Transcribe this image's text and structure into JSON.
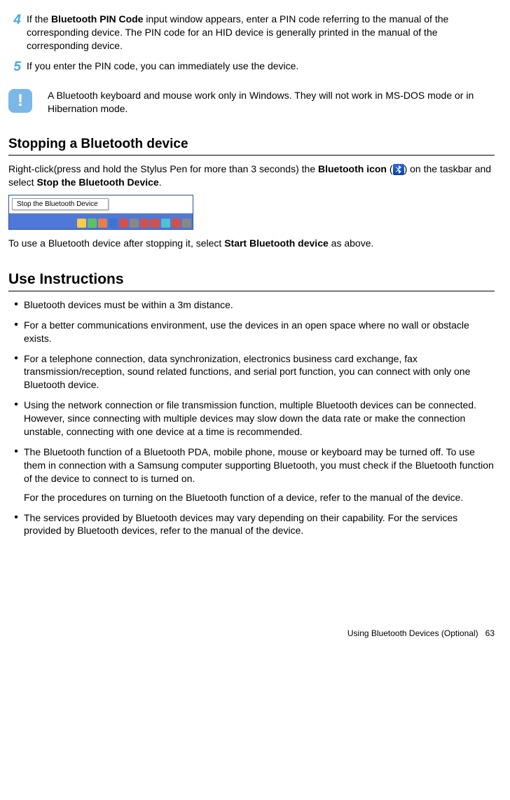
{
  "steps": [
    {
      "num": "4",
      "html": "If the <b>Bluetooth PIN Code</b> input window appears, enter a PIN code referring to the manual of the corresponding device. The PIN code for an HID device is generally printed in the manual of the corresponding device."
    },
    {
      "num": "5",
      "html": "If you enter the PIN code, you can immediately use the device."
    }
  ],
  "note": {
    "icon_char": "!",
    "text": "A Bluetooth keyboard and mouse work only in Windows. They will not work in MS-DOS mode or in Hibernation mode."
  },
  "stopping": {
    "title": "Stopping a Bluetooth device",
    "para1_pre": "Right-click(press and hold the Stylus Pen for more than 3 seconds) the ",
    "para1_bold1": "Bluetooth icon",
    "para1_mid1": " (",
    "para1_mid2": ") on the taskbar and select ",
    "para1_bold2": "Stop the Bluetooth Device",
    "para1_end": ".",
    "menu_label": "Stop the Bluetooth Device",
    "para2_pre": "To use a Bluetooth device after stopping it, select ",
    "para2_bold": "Start Bluetooth device",
    "para2_end": " as above."
  },
  "instructions": {
    "title": "Use Instructions",
    "bullets": [
      {
        "paras": [
          "Bluetooth devices must be within a 3m distance."
        ]
      },
      {
        "paras": [
          "For a better communications environment, use the devices in an open space where no wall or obstacle exists."
        ]
      },
      {
        "paras": [
          "For a telephone connection, data synchronization, electronics business card exchange, fax transmission/reception, sound related functions, and serial port function, you can connect with only one Bluetooth device."
        ]
      },
      {
        "paras": [
          "Using the network connection or file transmission function, multiple Bluetooth devices can be connected. However, since connecting with multiple devices may slow down the data rate or make the connection unstable, connecting with one device at a time is recommended."
        ]
      },
      {
        "paras": [
          "The Bluetooth function of a Bluetooth PDA, mobile phone, mouse or keyboard may be turned off. To use them in connection with a Samsung computer supporting Bluetooth, you must check if the Bluetooth function of the device to connect to is turned on.",
          "For the procedures on turning on the Bluetooth function of a device, refer to the manual of the device."
        ]
      },
      {
        "paras": [
          "The services provided by Bluetooth devices may vary depending on their capability. For the services provided by Bluetooth devices, refer to the manual of the device."
        ]
      }
    ]
  },
  "footer": {
    "section_title": "Using Bluetooth Devices (Optional)",
    "page_number": "63"
  }
}
